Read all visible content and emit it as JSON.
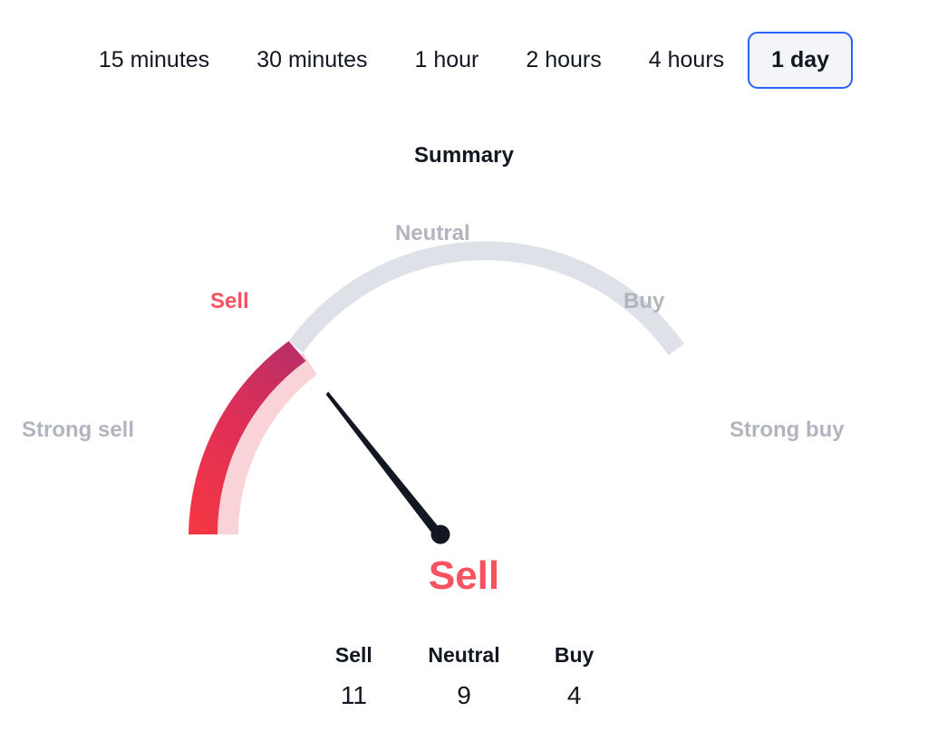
{
  "timeframe_tabs": {
    "items": [
      {
        "label": "15 minutes",
        "active": false
      },
      {
        "label": "30 minutes",
        "active": false
      },
      {
        "label": "1 hour",
        "active": false
      },
      {
        "label": "2 hours",
        "active": false
      },
      {
        "label": "4 hours",
        "active": false
      },
      {
        "label": "1 day",
        "active": true
      }
    ],
    "selected": "1 day",
    "active_border_color": "#2962ff",
    "active_background_color": "#f3f5f9"
  },
  "summary": {
    "title": "Summary",
    "verdict": "Sell",
    "verdict_color": "#f7525f"
  },
  "gauge": {
    "zone_labels": {
      "strong_sell": "Strong sell",
      "sell": "Sell",
      "neutral": "Neutral",
      "buy": "Buy",
      "strong_buy": "Strong buy"
    },
    "active_zone": "sell",
    "inactive_label_color": "#b2b5be",
    "active_label_color": "#f7525f",
    "track_color": "#dfe1e8",
    "fill_color_start": "#b82f68",
    "fill_color_end": "#f23645",
    "fill_inner_color": "#f9d3d8",
    "needle_color": "#131722"
  },
  "counts": {
    "columns": [
      {
        "label": "Sell",
        "value": "11"
      },
      {
        "label": "Neutral",
        "value": "9"
      },
      {
        "label": "Buy",
        "value": "4"
      }
    ]
  },
  "chart_data": {
    "type": "gauge",
    "title": "Summary",
    "categories": [
      "Strong sell",
      "Sell",
      "Neutral",
      "Buy",
      "Strong buy"
    ],
    "values": [
      11,
      9,
      4
    ],
    "value_labels": [
      "Sell",
      "Neutral",
      "Buy"
    ],
    "verdict": "Sell",
    "needle_zone": "Sell",
    "needle_angle_deg": 218.5,
    "arc_start_deg": 180,
    "arc_end_deg": 0,
    "gauge_segments": 5,
    "filled_fraction": 0.34,
    "legend": "bottom",
    "grid": false
  }
}
